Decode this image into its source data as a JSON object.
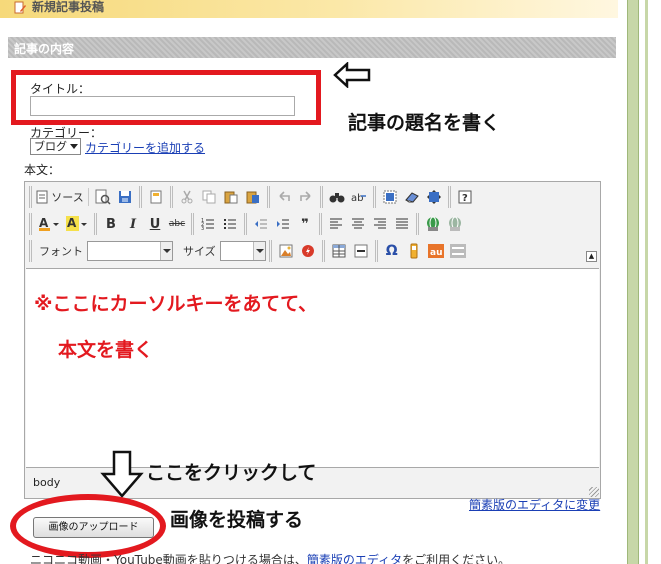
{
  "header": {
    "title": "新規記事投稿"
  },
  "section": {
    "title": "記事の内容"
  },
  "form": {
    "title_label": "タイトル：",
    "title_value": "",
    "category_label": "カテゴリー：",
    "category_selected": "ブログ",
    "add_category_link": "カテゴリーを追加する",
    "body_label": "本文："
  },
  "toolbar": {
    "source_label": "ソース",
    "bold": "B",
    "italic": "I",
    "underline": "U",
    "strike": "abc",
    "font_label": "フォント",
    "size_label": "サイズ",
    "omega": "Ω",
    "quote": "❞"
  },
  "editor": {
    "status_path": "body",
    "simple_editor_link": "簡素版のエディタに変更"
  },
  "upload": {
    "button_label": "画像のアップロード"
  },
  "annotations": {
    "title_note": "記事の題名を書く",
    "cursor_note": "※ここにカーソルキーをあてて、",
    "body_note": "本文を書く",
    "click_note": "ここをクリックして",
    "post_note": "画像を投稿する"
  },
  "footer": {
    "note_before": "ニコニコ動画・YouTube動画を貼りつける場合は、",
    "note_link": "簡素版のエディタ",
    "note_after": "をご利用ください。"
  },
  "colors": {
    "highlight_red": "#e3191f",
    "link_blue": "#1a3fb5",
    "header_yellow": "#f6d97a"
  }
}
